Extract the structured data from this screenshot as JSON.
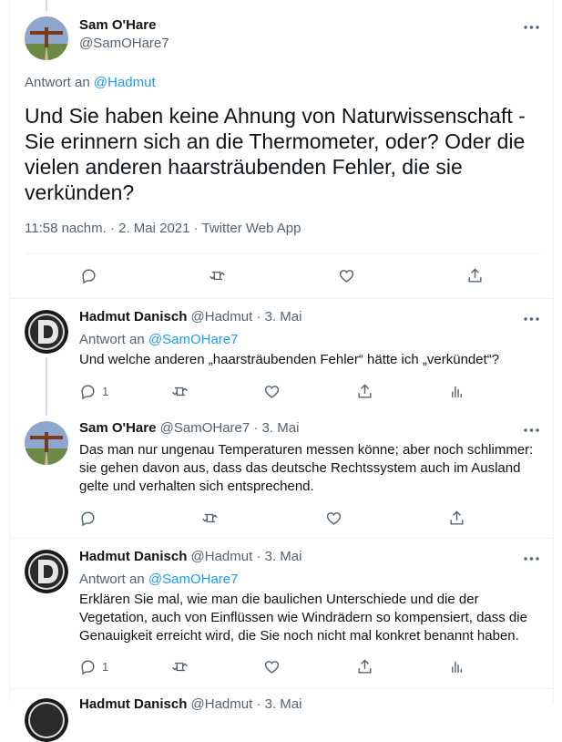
{
  "main_tweet": {
    "author_name": "Sam O'Hare",
    "author_handle": "@SamOHare7",
    "reply_prefix": "Antwort an",
    "reply_to": "@Hadmut",
    "text": "Und Sie haben keine Ahnung von Naturwissenschaft - Sie erinnern sich an die Thermometer, oder? Oder die vielen anderen haarsträubenden Fehler, die sie verkünden?",
    "meta": "11:58 nachm. · 2. Mai 2021 · Twitter Web App"
  },
  "replies": [
    {
      "author_name": "Hadmut Danisch",
      "author_handle": "@Hadmut",
      "date": "· 3. Mai",
      "reply_prefix": "Antwort an",
      "reply_to": "@SamOHare7",
      "text": "Und welche anderen „haarsträubenden Fehler“ hätte ich „verkündet“?",
      "reply_count": "1"
    },
    {
      "author_name": "Sam O'Hare",
      "author_handle": "@SamOHare7",
      "date": "· 3. Mai",
      "text": "Das man nur ungenau Temperaturen messen könne; aber noch schlimmer: sie gehen davon aus, dass das deutsche Rechtssystem auch im Ausland gelte und verhalten sich entsprechend."
    },
    {
      "author_name": "Hadmut Danisch",
      "author_handle": "@Hadmut",
      "date": "· 3. Mai",
      "reply_prefix": "Antwort an",
      "reply_to": "@SamOHare7",
      "text": "Erklären Sie mal, wie man die baulichen Unterschiede und die der Vegetation, auch von Einflüssen wie Windrädern so kompensiert, dass die Genauigkeit erreicht wird, die Sie noch nicht mal konkret benannt haben.",
      "reply_count": "1"
    }
  ],
  "partial_tweet": {
    "author_name": "Hadmut Danisch",
    "author_handle": "@Hadmut",
    "date": "· 3. Mai"
  },
  "colors": {
    "link": "#1d9bf0",
    "muted": "#536471",
    "border": "#eff3f4"
  }
}
